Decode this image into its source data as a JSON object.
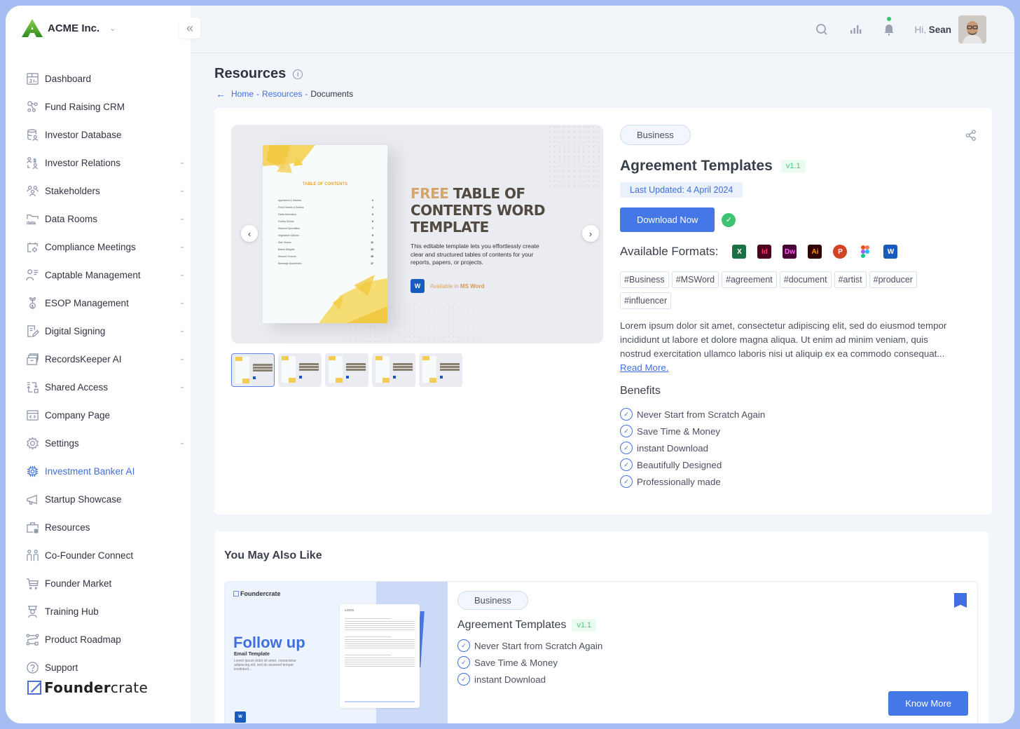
{
  "app": {
    "company": "ACME Inc.",
    "collapse_icon": "double-chevron-left-icon"
  },
  "sidebar": {
    "items": [
      {
        "label": "Dashboard",
        "icon": "dashboard-icon",
        "expandable": false,
        "active": false
      },
      {
        "label": "Fund Raising CRM",
        "icon": "crm-nodes-icon",
        "expandable": false,
        "active": false
      },
      {
        "label": "Investor Database",
        "icon": "database-user-icon",
        "expandable": false,
        "active": false
      },
      {
        "label": "Investor Relations",
        "icon": "investor-relations-icon",
        "expandable": true,
        "active": false
      },
      {
        "label": "Stakeholders",
        "icon": "users-group-icon",
        "expandable": true,
        "active": false
      },
      {
        "label": "Data Rooms",
        "icon": "data-folder-icon",
        "expandable": true,
        "active": false
      },
      {
        "label": "Compliance Meetings",
        "icon": "calendar-gear-icon",
        "expandable": true,
        "active": false
      },
      {
        "label": "Captable Management",
        "icon": "user-list-icon",
        "expandable": true,
        "active": false
      },
      {
        "label": "ESOP Management",
        "icon": "plant-coin-icon",
        "expandable": true,
        "active": false
      },
      {
        "label": "Digital Signing",
        "icon": "document-sign-icon",
        "expandable": true,
        "active": false
      },
      {
        "label": "RecordsKeeper AI",
        "icon": "archive-box-icon",
        "expandable": true,
        "active": false
      },
      {
        "label": "Shared Access",
        "icon": "share-access-icon",
        "expandable": true,
        "active": false
      },
      {
        "label": "Company Page",
        "icon": "browser-code-icon",
        "expandable": false,
        "active": false
      },
      {
        "label": "Settings",
        "icon": "gear-icon",
        "expandable": true,
        "active": false
      },
      {
        "label": "Investment Banker AI",
        "icon": "chip-icon",
        "expandable": false,
        "active": true
      },
      {
        "label": "Startup Showcase",
        "icon": "megaphone-icon",
        "expandable": false,
        "active": false
      },
      {
        "label": "Resources",
        "icon": "briefcase-icon",
        "expandable": false,
        "active": false
      },
      {
        "label": "Co-Founder Connect",
        "icon": "two-people-icon",
        "expandable": false,
        "active": false
      },
      {
        "label": "Founder Market",
        "icon": "cart-icon",
        "expandable": false,
        "active": false
      },
      {
        "label": "Training Hub",
        "icon": "trainer-icon",
        "expandable": false,
        "active": false
      },
      {
        "label": "Product Roadmap",
        "icon": "roadmap-icon",
        "expandable": false,
        "active": false
      },
      {
        "label": "Support",
        "icon": "help-circle-icon",
        "expandable": false,
        "active": false
      }
    ],
    "footer_logo_bold": "Founder",
    "footer_logo_light": "crate"
  },
  "topbar": {
    "greeting_prefix": "Hi,",
    "user_name": "Sean",
    "icons": [
      "search-icon",
      "chart-bars-icon",
      "bell-icon"
    ],
    "notification_dot_color": "#35c46e"
  },
  "page": {
    "title": "Resources",
    "breadcrumb": [
      {
        "label": "Home",
        "link": true
      },
      {
        "label": "Resources",
        "link": true
      },
      {
        "label": "Documents",
        "link": false
      }
    ]
  },
  "preview": {
    "headline_accent": "FREE",
    "headline_rest": "TABLE OF CONTENTS WORD TEMPLATE",
    "description": "This editable template lets you effortlessly create clear and structured tables of contents for your reports, papers, or projects.",
    "available_prefix": "Available in",
    "available_app": "MS Word",
    "doc_title": "TABLE OF CONTENTS",
    "toc": [
      {
        "label": "Appetizers & Starters",
        "page": "1"
      },
      {
        "label": "Fresh Salads & Greens",
        "page": "2"
      },
      {
        "label": "Pasta Selections",
        "page": "3"
      },
      {
        "label": "Poultry Dishes",
        "page": "5"
      },
      {
        "label": "Seafood Specialties",
        "page": "7"
      },
      {
        "label": "Vegetarian Options",
        "page": "9"
      },
      {
        "label": "Side Dishes",
        "page": "11"
      },
      {
        "label": "Baked Delights",
        "page": "13"
      },
      {
        "label": "Dessert Choices",
        "page": "15"
      },
      {
        "label": "Beverage Assortment",
        "page": "17"
      }
    ],
    "thumbnail_count": 5,
    "active_thumbnail": 1
  },
  "product": {
    "category": "Business",
    "title": "Agreement Templates",
    "version": "v1.1",
    "last_updated": "Last Updated: 4 April 2024",
    "download_label": "Download Now",
    "formats_label": "Available Formats:",
    "formats": [
      {
        "name": "excel-icon",
        "glyph": "X",
        "bg": "#1d7044",
        "fg": "#ffffff"
      },
      {
        "name": "indesign-icon",
        "glyph": "Id",
        "bg": "#49021f",
        "fg": "#ff3366"
      },
      {
        "name": "dreamweaver-icon",
        "glyph": "Dw",
        "bg": "#470137",
        "fg": "#ff61f6"
      },
      {
        "name": "illustrator-icon",
        "glyph": "Ai",
        "bg": "#330000",
        "fg": "#ff9a00"
      },
      {
        "name": "powerpoint-icon",
        "glyph": "P",
        "bg": "#d04423",
        "fg": "#ffffff"
      },
      {
        "name": "figma-icon",
        "glyph": "",
        "bg": "#ffffff",
        "fg": "#a259ff"
      },
      {
        "name": "word-icon",
        "glyph": "W",
        "bg": "#185abd",
        "fg": "#ffffff"
      }
    ],
    "tags": [
      "#Business",
      "#MSWord",
      "#agreement",
      "#document",
      "#artist",
      "#producer",
      "#influencer"
    ],
    "description": "Lorem ipsum dolor sit amet, consectetur adipiscing elit, sed do eiusmod tempor incididunt ut labore et dolore magna aliqua. Ut enim ad minim veniam, quis nostrud exercitation ullamco laboris nisi ut aliquip ex ea commodo consequat...",
    "read_more": "Read More.",
    "benefits_title": "Benefits",
    "benefits": [
      "Never Start from Scratch Again",
      "Save Time & Money",
      "instant Download",
      "Beautifully Designed",
      "Professionally made"
    ]
  },
  "recommendations": {
    "title": "You May Also Like",
    "items": [
      {
        "image": {
          "brand": "Foundercrate",
          "headline": "Follow up",
          "subhead": "Email Template",
          "text": "Lorem ipsum dolor sit amet, consectetur adipiscing elit, sed do eiusmod tempor incididunt...",
          "doc_logo": "LOGO"
        },
        "category": "Business",
        "title": "Agreement Templates",
        "version": "v1.1",
        "benefits": [
          "Never Start from Scratch Again",
          "Save Time & Money",
          "instant Download"
        ],
        "button": "Know More",
        "bookmarked": true
      }
    ]
  },
  "colors": {
    "accent": "#3f6fe0",
    "button": "#4677e6",
    "success": "#3ec373",
    "frame": "#a5bdf3",
    "background": "#f2f5f9"
  }
}
